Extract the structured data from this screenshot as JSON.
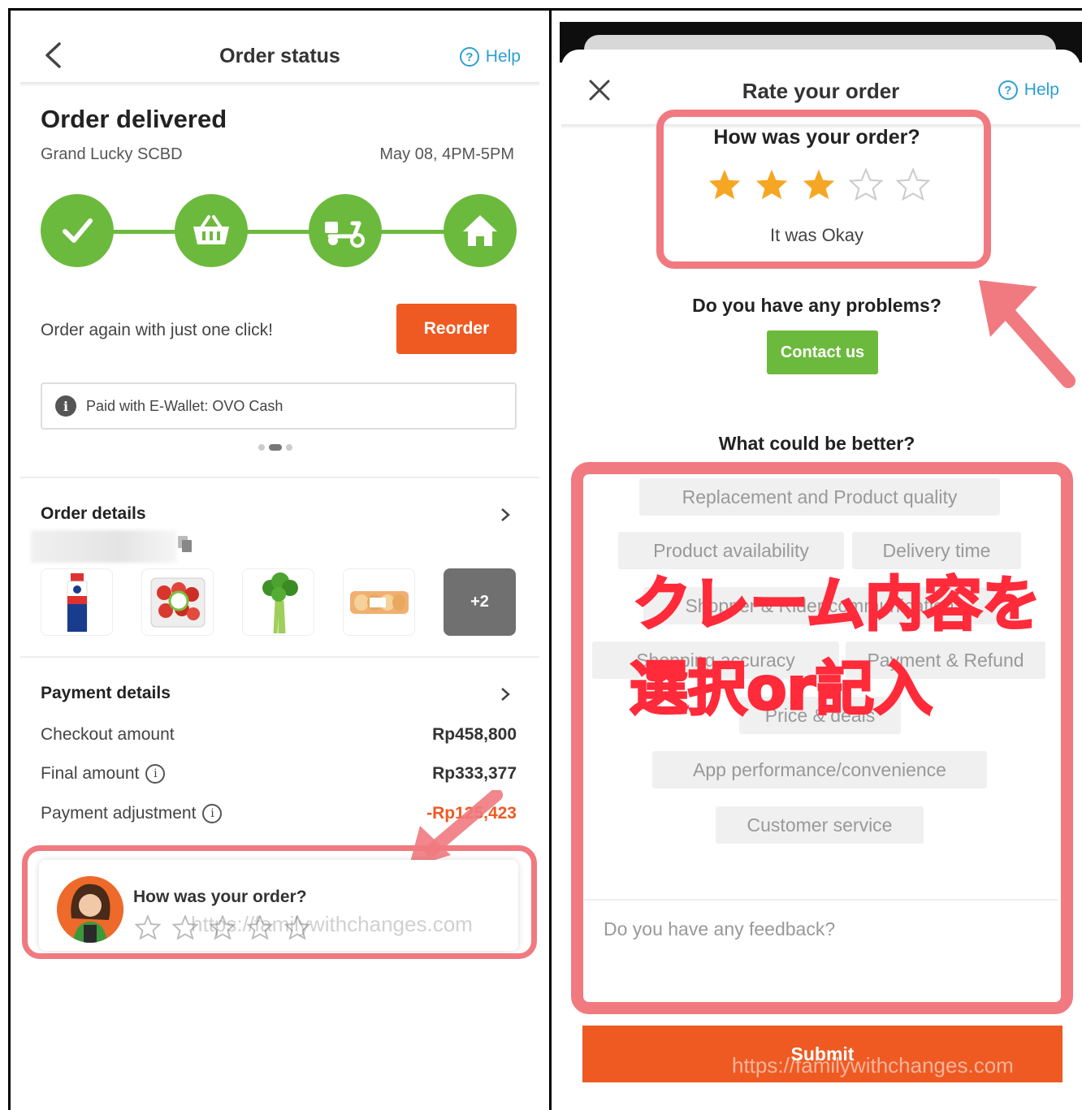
{
  "left": {
    "header": {
      "title": "Order status",
      "help_label": "Help"
    },
    "status": {
      "heading": "Order delivered",
      "store": "Grand Lucky SCBD",
      "slot": "May 08, 4PM-5PM"
    },
    "steps": [
      "check-icon",
      "basket-icon",
      "scooter-icon",
      "home-icon"
    ],
    "reorder": {
      "text": "Order again with just one click!",
      "button": "Reorder"
    },
    "payment_info": "Paid with E-Wallet: OVO Cash",
    "order_details": {
      "title": "Order details",
      "more_count": "+2"
    },
    "payment_details": {
      "title": "Payment details",
      "rows": [
        {
          "label": "Checkout amount",
          "value": "Rp458,800"
        },
        {
          "label": "Final amount",
          "value": "Rp333,377"
        },
        {
          "label": "Payment adjustment",
          "value": "-Rp125,423"
        }
      ]
    },
    "rate_card": {
      "title": "How was your order?",
      "stars": 0
    },
    "watermark": "https://familywithchanges.com"
  },
  "right": {
    "header": {
      "title": "Rate your order",
      "help_label": "Help"
    },
    "question": "How was your order?",
    "rating": {
      "value": 3,
      "max": 5,
      "label": "It was Okay"
    },
    "problems": {
      "title": "Do you have any problems?",
      "button": "Contact us"
    },
    "better": {
      "title": "What could be better?",
      "chips": [
        "Replacement and Product quality",
        "Product availability",
        "Delivery time",
        "Shopper & Rider communication",
        "Shopping accuracy",
        "Payment & Refund",
        "Price & deals",
        "App performance/convenience",
        "Customer service"
      ]
    },
    "feedback_placeholder": "Do you have any feedback?",
    "submit": "Submit",
    "annotation": {
      "line1": "クレーム内容を",
      "line2": "選択or記入"
    },
    "watermark": "https://familywithchanges.com"
  },
  "colors": {
    "brand_orange": "#ee5a22",
    "brand_green": "#6cba3d",
    "help_blue": "#2b9fd6",
    "highlight": "#f07a80",
    "annotation_red": "#ff2a3a",
    "star_orange": "#f5a623"
  }
}
